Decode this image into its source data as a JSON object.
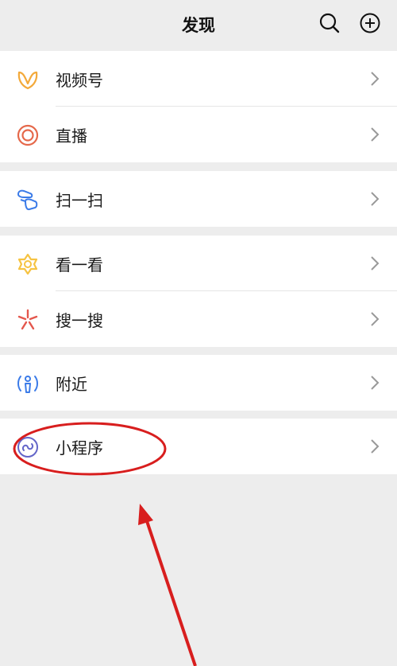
{
  "header": {
    "title": "发现",
    "search_icon": "search-icon",
    "add_icon": "plus-circle-icon"
  },
  "menu": {
    "channels": {
      "label": "视频号",
      "icon": "channels-icon",
      "color": "#f3a93a"
    },
    "live": {
      "label": "直播",
      "icon": "live-icon",
      "color": "#e5684a"
    },
    "scan": {
      "label": "扫一扫",
      "icon": "scan-icon",
      "color": "#3b7be8"
    },
    "top_stories": {
      "label": "看一看",
      "icon": "top-stories-icon",
      "color": "#f6c342"
    },
    "search": {
      "label": "搜一搜",
      "icon": "search-spark-icon",
      "color": "#e4574d"
    },
    "nearby": {
      "label": "附近",
      "icon": "nearby-icon",
      "color": "#3b7be8"
    },
    "mini_programs": {
      "label": "小程序",
      "icon": "mini-program-icon",
      "color": "#6466c9"
    }
  },
  "annotation_color": "#d81e1e"
}
